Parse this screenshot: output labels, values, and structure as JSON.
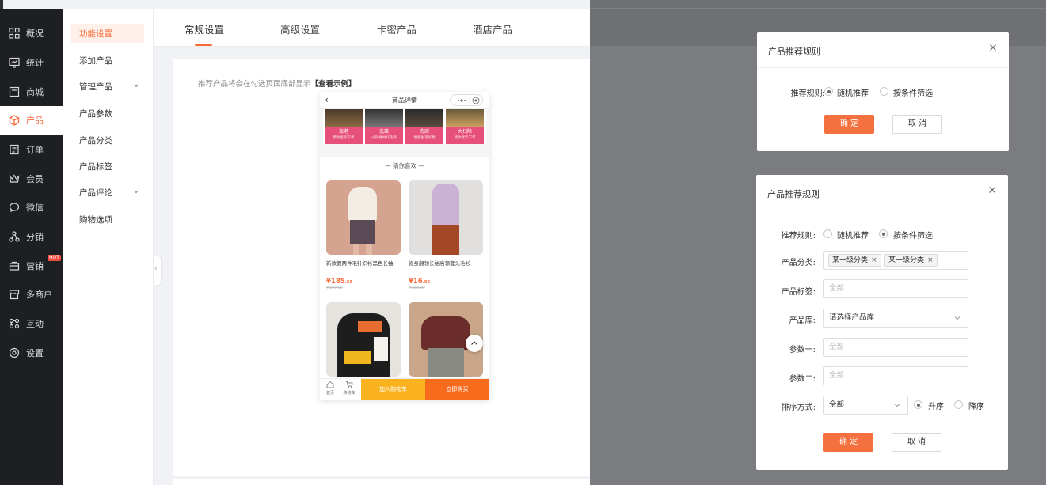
{
  "sidebar": {
    "items": [
      {
        "label": "概况",
        "icon": "grid-icon"
      },
      {
        "label": "统计",
        "icon": "chart-icon"
      },
      {
        "label": "商城",
        "icon": "store-icon"
      },
      {
        "label": "产品",
        "icon": "product-icon"
      },
      {
        "label": "订单",
        "icon": "order-icon"
      },
      {
        "label": "会员",
        "icon": "crown-icon"
      },
      {
        "label": "微信",
        "icon": "chat-icon"
      },
      {
        "label": "分销",
        "icon": "distribution-icon"
      },
      {
        "label": "营销",
        "icon": "marketing-icon",
        "badge": "HOT"
      },
      {
        "label": "多商户",
        "icon": "shop-icon"
      },
      {
        "label": "互动",
        "icon": "interact-icon"
      },
      {
        "label": "设置",
        "icon": "settings-icon"
      }
    ],
    "active": "产品"
  },
  "subnav": {
    "items": [
      "功能设置",
      "添加产品",
      "管理产品",
      "产品参数",
      "产品分类",
      "产品标签",
      "产品评论",
      "购物选项"
    ],
    "active": "功能设置"
  },
  "tabs": [
    "常规设置",
    "高级设置",
    "卡密产品",
    "酒店产品"
  ],
  "active_tab": "常规设置",
  "tip": {
    "text": "推荐产品将会在勾选页面底部显示",
    "link": "【查看示例】"
  },
  "phone": {
    "title": "商品详情",
    "categories": [
      {
        "name": "海港",
        "sub": "猜你喜欢下单"
      },
      {
        "name": "洗菜",
        "sub": "火锅食材好选择"
      },
      {
        "name": "洗碗",
        "sub": "便捷生活好物"
      },
      {
        "name": "大扫除",
        "sub": "猜你喜欢下单"
      }
    ],
    "recommend_title": "猜你喜欢",
    "products": [
      {
        "name": "新款假两件毛针织衫黑色长袖",
        "price": "¥185",
        "cents": ".55",
        "old": "¥299.00"
      },
      {
        "name": "修身翻领长袖高领套头毛衫",
        "price": "¥16",
        "cents": ".55",
        "old": "¥299.00"
      }
    ],
    "bar": {
      "home": "首页",
      "cart": "购物车",
      "add_cart": "加入购物车",
      "buy": "立即购买"
    }
  },
  "modal1": {
    "title": "产品推荐规则",
    "rule_label": "推荐规则:",
    "opt_random": "随机推荐",
    "opt_filter": "按条件筛选",
    "selected": "随机推荐",
    "ok": "确 定",
    "cancel": "取 消"
  },
  "modal2": {
    "title": "产品推荐规则",
    "rule_label": "推荐规则:",
    "opt_random": "随机推荐",
    "opt_filter": "按条件筛选",
    "selected": "按条件筛选",
    "category_label": "产品分类:",
    "category_tags": [
      "某一级分类",
      "某一级分类"
    ],
    "tag_label": "产品标签:",
    "tag_placeholder": "全部",
    "library_label": "产品库:",
    "library_placeholder": "请选择产品库",
    "param1_label": "参数一:",
    "param1_placeholder": "全部",
    "param2_label": "参数二:",
    "param2_placeholder": "全部",
    "sort_label": "排序方式:",
    "sort_value": "全部",
    "asc": "升序",
    "desc": "降序",
    "sort_selected": "升序",
    "ok": "确 定",
    "cancel": "取 消"
  },
  "colors": {
    "accent": "#f76b3b",
    "sidebar_bg": "#1d1f23",
    "overlay": "#7b7c7f"
  }
}
